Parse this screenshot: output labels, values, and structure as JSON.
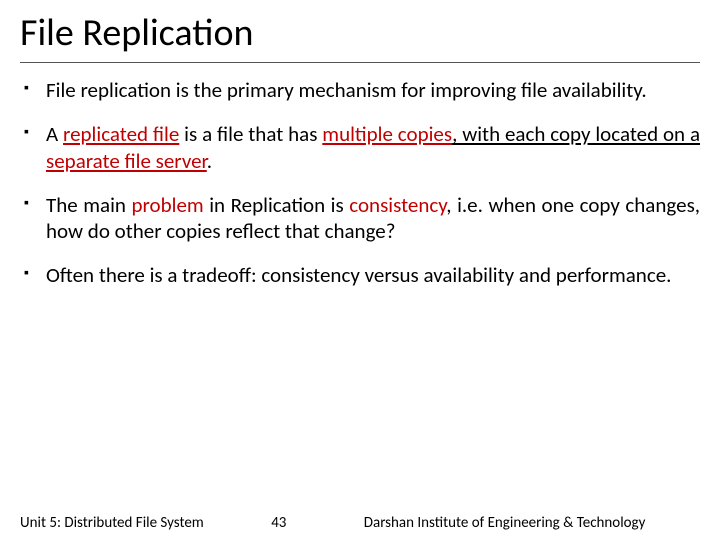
{
  "title": "File Replication",
  "bullets": {
    "b1a": "File replication is the primary mechanism for improving file availability.",
    "b2_pre": "A ",
    "b2_hl1": "replicated file",
    "b2_mid1": " is a file that has ",
    "b2_hl2": "multiple copies",
    "b2_mid2": ", with each copy located on a ",
    "b2_hl3": "separate file server",
    "b2_end": ".",
    "b3_pre": "The main ",
    "b3_hl1": "problem",
    "b3_mid1": " in Replication is ",
    "b3_hl2": "consistency",
    "b3_end": ", i.e. when one copy changes, how do other copies reflect that change?",
    "b4": "Often there is a tradeoff: consistency versus availability and performance."
  },
  "footer": {
    "unit": "Unit 5: Distributed File System",
    "page": "43",
    "inst": "Darshan Institute of Engineering & Technology"
  }
}
